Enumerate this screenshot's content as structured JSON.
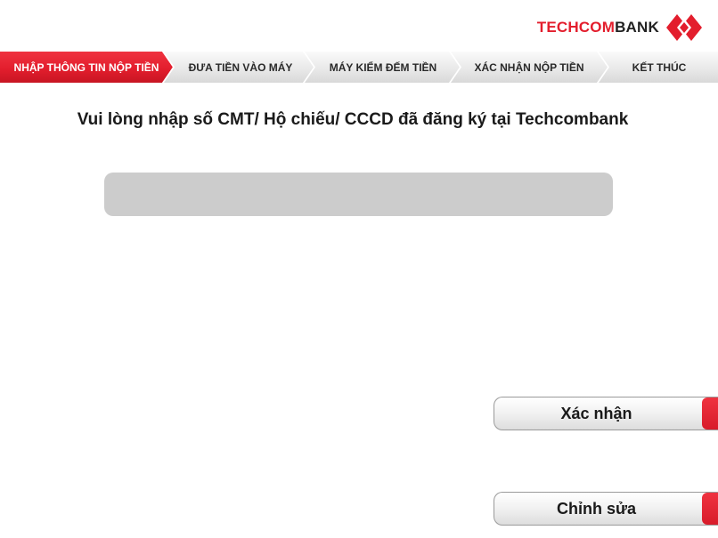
{
  "brand": {
    "name_part1": "TECHCOM",
    "name_part2": "BANK",
    "logo_icon": "techcombank-diamond-logo-icon",
    "color_primary": "#e31e2d"
  },
  "steps": [
    {
      "label": "NHẬP THÔNG TIN NỘP TIỀN",
      "active": true
    },
    {
      "label": "ĐƯA TIỀN VÀO MÁY",
      "active": false
    },
    {
      "label": "MÁY KIỂM ĐẾM TIỀN",
      "active": false
    },
    {
      "label": "XÁC NHẬN NỘP TIỀN",
      "active": false
    },
    {
      "label": "KẾT THÚC",
      "active": false
    }
  ],
  "main": {
    "prompt": "Vui lòng nhập số CMT/ Hộ chiếu/ CCCD đã đăng ký tại Techcombank",
    "id_input_value": ""
  },
  "actions": {
    "confirm_label": "Xác nhận",
    "edit_label": "Chỉnh sửa"
  }
}
